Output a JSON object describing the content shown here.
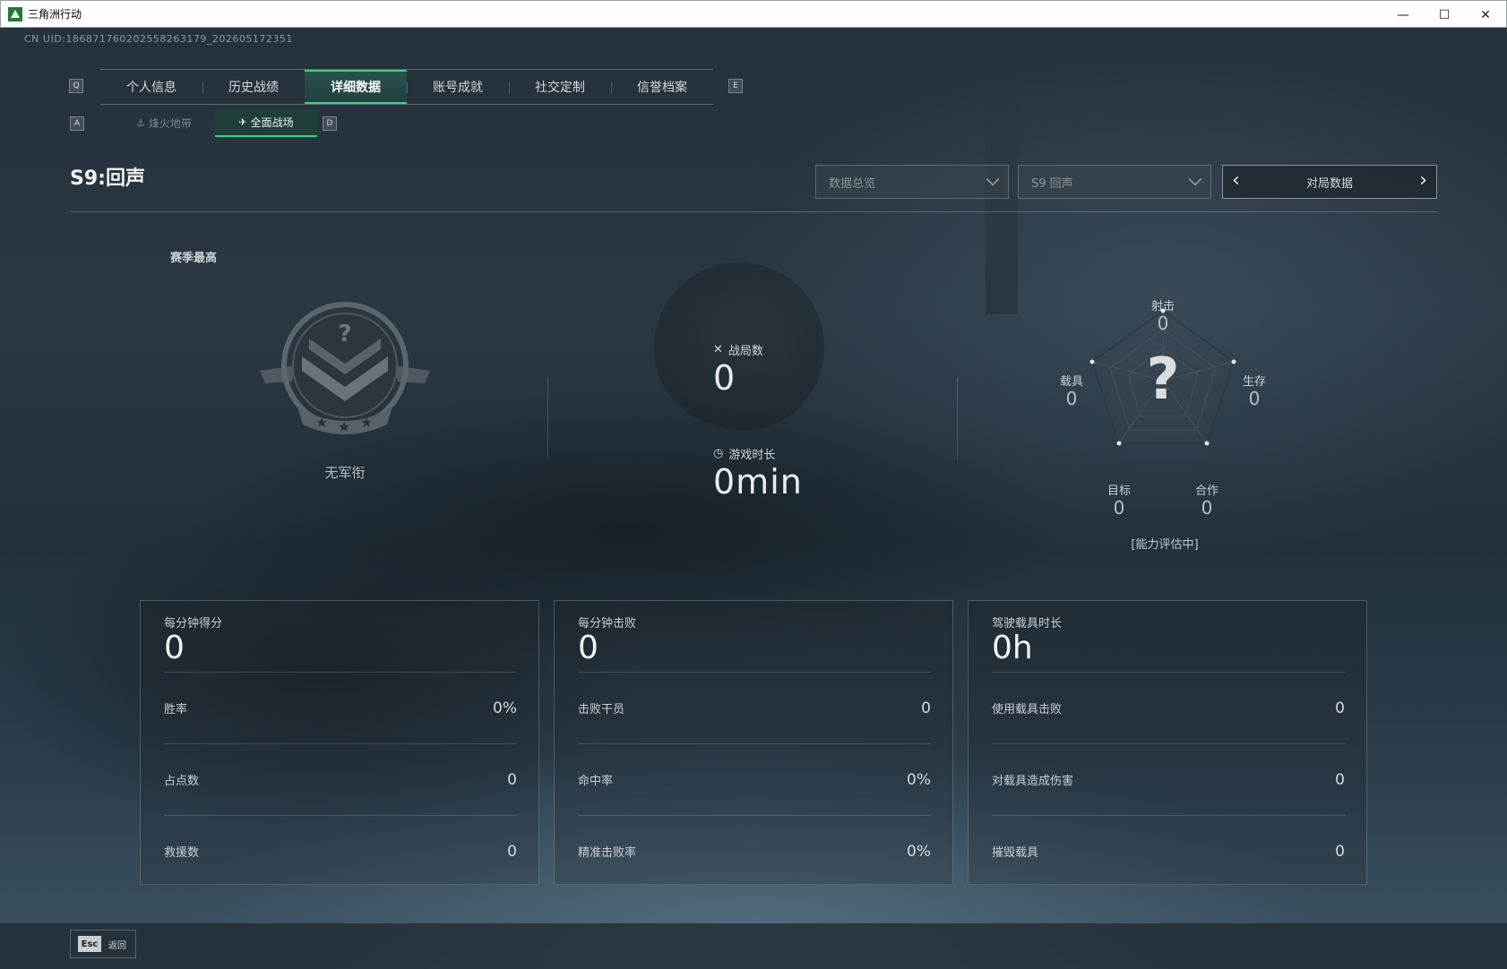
{
  "window": {
    "title": "三角洲行动",
    "min_glyph": "—",
    "max_glyph": "☐",
    "close_glyph": "✕"
  },
  "uid": "CN UID:18687176020255826317​9_202605172351",
  "keyhints": {
    "q": "Q",
    "e": "E",
    "a": "A",
    "d": "D"
  },
  "tabs": [
    {
      "label": "个人信息",
      "active": false
    },
    {
      "label": "历史战绩",
      "active": false
    },
    {
      "label": "详细数据",
      "active": true
    },
    {
      "label": "账号成就",
      "active": false
    },
    {
      "label": "社交定制",
      "active": false
    },
    {
      "label": "信誉档案",
      "active": false
    }
  ],
  "subtabs": [
    {
      "label": "烽火地带",
      "icon": "flame-zone-icon",
      "active": false
    },
    {
      "label": "全面战场",
      "icon": "battlefield-icon",
      "active": true
    }
  ],
  "season": {
    "title": "S9:回声"
  },
  "filters": {
    "data_type": "数据总览",
    "season": "S9 回声",
    "pager_label": "对局数据"
  },
  "rank": {
    "section_label": "赛季最高",
    "name": "无军衔",
    "unknown_mark": "?"
  },
  "matches": {
    "label": "战局数",
    "value": "0",
    "icon": "crossed-swords-icon"
  },
  "playtime": {
    "label": "游戏时长",
    "value": "0min",
    "icon": "clock-icon"
  },
  "radar": {
    "center": "?",
    "axes": [
      {
        "label": "射击",
        "value": "0"
      },
      {
        "label": "生存",
        "value": "0"
      },
      {
        "label": "合作",
        "value": "0"
      },
      {
        "label": "目标",
        "value": "0"
      },
      {
        "label": "载具",
        "value": "0"
      }
    ],
    "status": "[能力评估中]"
  },
  "cards": [
    {
      "head_label": "每分钟得分",
      "head_value": "0",
      "rows": [
        {
          "label": "胜率",
          "value": "0%"
        },
        {
          "label": "占点数",
          "value": "0"
        },
        {
          "label": "救援数",
          "value": "0"
        }
      ]
    },
    {
      "head_label": "每分钟击败",
      "head_value": "0",
      "rows": [
        {
          "label": "击败干员",
          "value": "0"
        },
        {
          "label": "命中率",
          "value": "0%"
        },
        {
          "label": "精准击败率",
          "value": "0%"
        }
      ]
    },
    {
      "head_label": "驾驶载具时长",
      "head_value": "0h",
      "rows": [
        {
          "label": "使用载具击败",
          "value": "0"
        },
        {
          "label": "对载具造成伤害",
          "value": "0"
        },
        {
          "label": "摧毁载具",
          "value": "0"
        }
      ]
    }
  ],
  "footer": {
    "esc_key": "Esc",
    "esc_label": "返回"
  },
  "colors": {
    "accent": "#3ad08e",
    "background": "#25313b",
    "text": "#c8ccd0"
  }
}
